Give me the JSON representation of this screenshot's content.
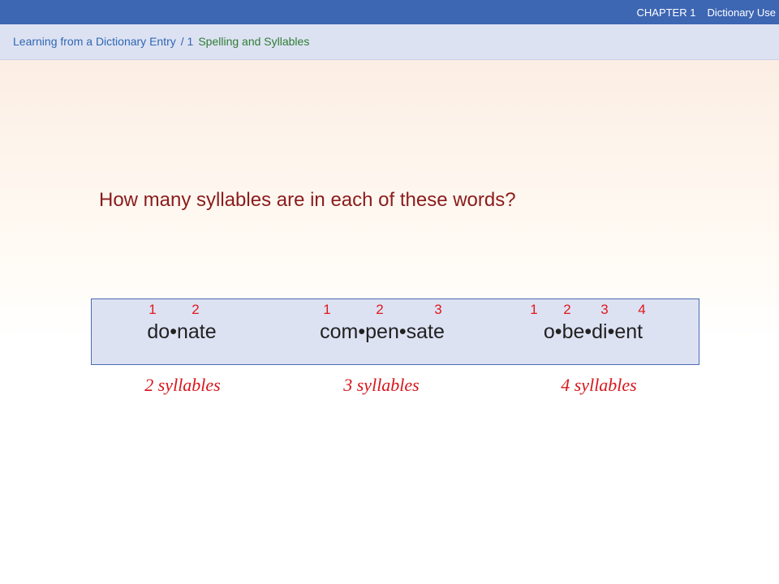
{
  "header": {
    "chapter_label": "CHAPTER 1",
    "chapter_title": "Dictionary Use"
  },
  "breadcrumb": {
    "section": "Learning from a Dictionary Entry",
    "separator": "/ 1",
    "topic": "Spelling and Syllables"
  },
  "slide": {
    "question": "How many syllables are in each of these words?",
    "words": [
      {
        "text": "do•nate",
        "numbers": [
          "1",
          "2"
        ],
        "count_label": "2 syllables"
      },
      {
        "text": "com•pen•sate",
        "numbers": [
          "1",
          "2",
          "3"
        ],
        "count_label": "3 syllables"
      },
      {
        "text": "o•be•di•ent",
        "numbers": [
          "1",
          "2",
          "3",
          "4"
        ],
        "count_label": "4 syllables"
      }
    ]
  },
  "colors": {
    "top_bar": "#3d66b3",
    "sub_bar": "#dde2f3",
    "question_text": "#8b1c1c",
    "syllable_numbers": "#e0181b",
    "count_text": "#d8161c"
  }
}
